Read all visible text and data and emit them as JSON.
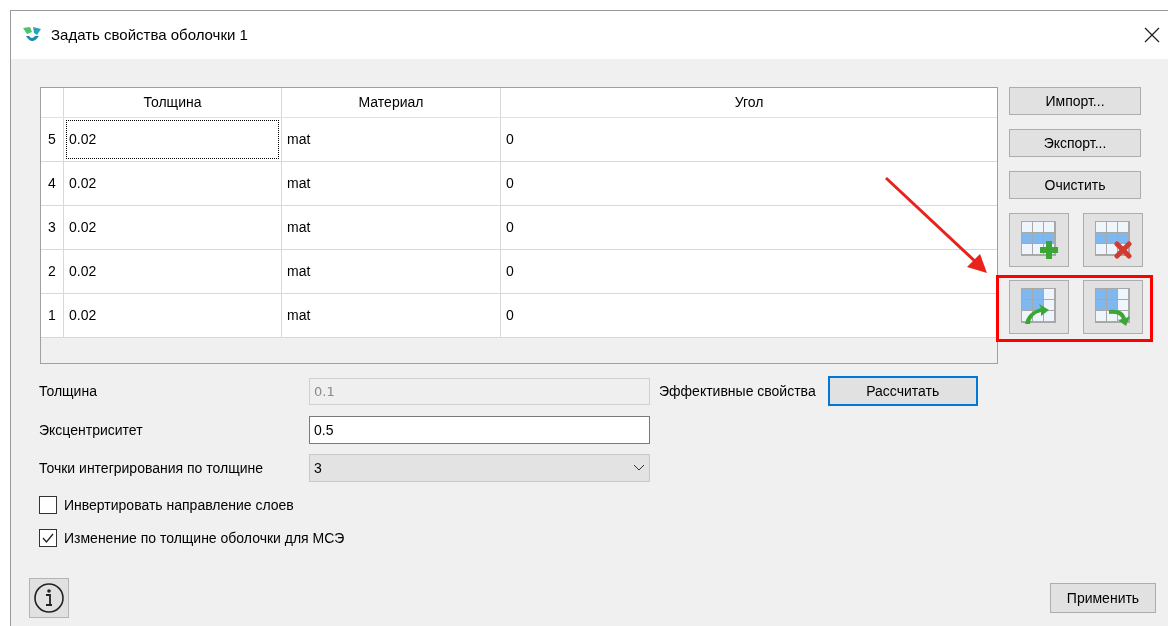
{
  "window": {
    "title": "Задать свойства оболочки 1"
  },
  "table": {
    "columns": [
      "Толщина",
      "Материал",
      "Угол"
    ],
    "rows": [
      {
        "number": "5",
        "thickness": "0.02",
        "material": "mat",
        "angle": "0",
        "focused": true
      },
      {
        "number": "4",
        "thickness": "0.02",
        "material": "mat",
        "angle": "0",
        "focused": false
      },
      {
        "number": "3",
        "thickness": "0.02",
        "material": "mat",
        "angle": "0",
        "focused": false
      },
      {
        "number": "2",
        "thickness": "0.02",
        "material": "mat",
        "angle": "0",
        "focused": false
      },
      {
        "number": "1",
        "thickness": "0.02",
        "material": "mat",
        "angle": "0",
        "focused": false
      }
    ]
  },
  "side_buttons": [
    "Импорт...",
    "Экспорт...",
    "Очистить"
  ],
  "icon_buttons": [
    {
      "kind": "add-row"
    },
    {
      "kind": "delete-row"
    },
    {
      "kind": "move-up"
    },
    {
      "kind": "move-down"
    }
  ],
  "annotations": {
    "highlight_box": true,
    "arrow": true
  },
  "form": {
    "thickness": {
      "label": "Толщина",
      "value": "0.1",
      "disabled": true
    },
    "effective_label": "Эффективные свойства",
    "calculate_button": "Рассчитать",
    "eccentricity": {
      "label": "Эксцентриситет",
      "value": "0.5",
      "disabled": false
    },
    "integration_points": {
      "label": "Точки интегрирования по толщине",
      "value": "3"
    }
  },
  "checkboxes": [
    {
      "label": "Инвертировать направление слоев",
      "checked": false
    },
    {
      "label": "Изменение по толщине оболочки для МСЭ",
      "checked": true
    }
  ],
  "apply_button": "Применить"
}
